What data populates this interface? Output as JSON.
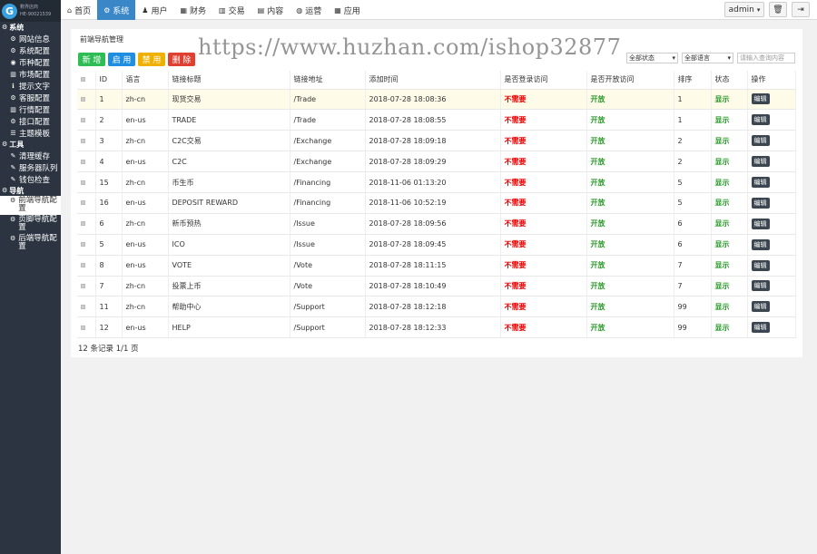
{
  "brand": {
    "line1": "數界店商",
    "line2": "HE-90021539"
  },
  "sidebar": [
    {
      "type": "section",
      "label": "系统",
      "icon": "gear-icon",
      "glyph": "⚙"
    },
    {
      "type": "item",
      "label": "网站信息",
      "icon": "gear-icon",
      "glyph": "⚙"
    },
    {
      "type": "item",
      "label": "系统配置",
      "icon": "gear-icon",
      "glyph": "⚙"
    },
    {
      "type": "item",
      "label": "币种配置",
      "icon": "coin-icon",
      "glyph": "◉"
    },
    {
      "type": "item",
      "label": "市场配置",
      "icon": "chart-icon",
      "glyph": "▥"
    },
    {
      "type": "item",
      "label": "提示文字",
      "icon": "info-icon",
      "glyph": "ℹ"
    },
    {
      "type": "item",
      "label": "客服配置",
      "icon": "gear-icon",
      "glyph": "⚙"
    },
    {
      "type": "item",
      "label": "行情配置",
      "icon": "bar-chart-icon",
      "glyph": "▥"
    },
    {
      "type": "item",
      "label": "接口配置",
      "icon": "gear-icon",
      "glyph": "⚙"
    },
    {
      "type": "item",
      "label": "主题模板",
      "icon": "list-icon",
      "glyph": "☰"
    },
    {
      "type": "section",
      "label": "工具",
      "icon": "gear-icon",
      "glyph": "⚙"
    },
    {
      "type": "item",
      "label": "清理缓存",
      "icon": "wrench-icon",
      "glyph": "✎"
    },
    {
      "type": "item",
      "label": "服务器队列",
      "icon": "wrench-icon",
      "glyph": "✎"
    },
    {
      "type": "item",
      "label": "钱包检查",
      "icon": "wrench-icon",
      "glyph": "✎"
    },
    {
      "type": "section",
      "label": "导航",
      "icon": "gear-icon",
      "glyph": "⚙"
    },
    {
      "type": "item",
      "label": "前端导航配置",
      "icon": "gear-icon",
      "glyph": "⚙",
      "active": true,
      "tall": true
    },
    {
      "type": "item",
      "label": "页脚导航配置",
      "icon": "gear-icon",
      "glyph": "⚙",
      "tall": true
    },
    {
      "type": "item",
      "label": "后端导航配置",
      "icon": "gear-icon",
      "glyph": "⚙",
      "tall": true
    }
  ],
  "topnav": [
    {
      "label": "首页",
      "icon": "home-icon",
      "glyph": "⌂"
    },
    {
      "label": "系统",
      "icon": "gear-icon",
      "glyph": "⚙",
      "active": true
    },
    {
      "label": "用户",
      "icon": "user-icon",
      "glyph": "♟"
    },
    {
      "label": "财务",
      "icon": "table-icon",
      "glyph": "▦"
    },
    {
      "label": "交易",
      "icon": "bar-chart-icon",
      "glyph": "▥"
    },
    {
      "label": "内容",
      "icon": "document-icon",
      "glyph": "▤"
    },
    {
      "label": "运营",
      "icon": "globe-icon",
      "glyph": "◍"
    },
    {
      "label": "应用",
      "icon": "grid-icon",
      "glyph": "▦"
    }
  ],
  "topright": {
    "admin_label": "admin",
    "admin_caret": "▾",
    "trash_glyph": "🗑",
    "logout_glyph": "⇥"
  },
  "panel_title": "前端导航管理",
  "buttons": [
    {
      "label": "新 增",
      "color": "#2ebc54"
    },
    {
      "label": "启 用",
      "color": "#1e8ee0"
    },
    {
      "label": "禁 用",
      "color": "#f0b000"
    },
    {
      "label": "删 除",
      "color": "#e04030"
    }
  ],
  "filters": {
    "status": "全部状态",
    "lang": "全部语言",
    "caret": "▾",
    "search_placeholder": "请输入查询内容"
  },
  "columns": [
    "",
    "ID",
    "语言",
    "链接标题",
    "链接地址",
    "添加时间",
    "是否登录访问",
    "是否开放访问",
    "排序",
    "状态",
    "操作"
  ],
  "rows": [
    {
      "id": "1",
      "lang": "zh-cn",
      "title": "现货交易",
      "url": "/Trade",
      "time": "2018-07-28 18:08:36",
      "login": "不需要",
      "open": "开放",
      "sort": "1",
      "status": "显示",
      "op": "编辑",
      "hl": true
    },
    {
      "id": "2",
      "lang": "en-us",
      "title": "TRADE",
      "url": "/Trade",
      "time": "2018-07-28 18:08:55",
      "login": "不需要",
      "open": "开放",
      "sort": "1",
      "status": "显示",
      "op": "编辑"
    },
    {
      "id": "3",
      "lang": "zh-cn",
      "title": "C2C交易",
      "url": "/Exchange",
      "time": "2018-07-28 18:09:18",
      "login": "不需要",
      "open": "开放",
      "sort": "2",
      "status": "显示",
      "op": "编辑"
    },
    {
      "id": "4",
      "lang": "en-us",
      "title": "C2C",
      "url": "/Exchange",
      "time": "2018-07-28 18:09:29",
      "login": "不需要",
      "open": "开放",
      "sort": "2",
      "status": "显示",
      "op": "编辑"
    },
    {
      "id": "15",
      "lang": "zh-cn",
      "title": "币生币",
      "url": "/Financing",
      "time": "2018-11-06 01:13:20",
      "login": "不需要",
      "open": "开放",
      "sort": "5",
      "status": "显示",
      "op": "编辑"
    },
    {
      "id": "16",
      "lang": "en-us",
      "title": "DEPOSIT REWARD",
      "url": "/Financing",
      "time": "2018-11-06 10:52:19",
      "login": "不需要",
      "open": "开放",
      "sort": "5",
      "status": "显示",
      "op": "编辑"
    },
    {
      "id": "6",
      "lang": "zh-cn",
      "title": "新币预热",
      "url": "/Issue",
      "time": "2018-07-28 18:09:56",
      "login": "不需要",
      "open": "开放",
      "sort": "6",
      "status": "显示",
      "op": "编辑"
    },
    {
      "id": "5",
      "lang": "en-us",
      "title": "ICO",
      "url": "/Issue",
      "time": "2018-07-28 18:09:45",
      "login": "不需要",
      "open": "开放",
      "sort": "6",
      "status": "显示",
      "op": "编辑"
    },
    {
      "id": "8",
      "lang": "en-us",
      "title": "VOTE",
      "url": "/Vote",
      "time": "2018-07-28 18:11:15",
      "login": "不需要",
      "open": "开放",
      "sort": "7",
      "status": "显示",
      "op": "编辑"
    },
    {
      "id": "7",
      "lang": "zh-cn",
      "title": "投票上币",
      "url": "/Vote",
      "time": "2018-07-28 18:10:49",
      "login": "不需要",
      "open": "开放",
      "sort": "7",
      "status": "显示",
      "op": "编辑"
    },
    {
      "id": "11",
      "lang": "zh-cn",
      "title": "帮助中心",
      "url": "/Support",
      "time": "2018-07-28 18:12:18",
      "login": "不需要",
      "open": "开放",
      "sort": "99",
      "status": "显示",
      "op": "编辑"
    },
    {
      "id": "12",
      "lang": "en-us",
      "title": "HELP",
      "url": "/Support",
      "time": "2018-07-28 18:12:33",
      "login": "不需要",
      "open": "开放",
      "sort": "99",
      "status": "显示",
      "op": "编辑"
    }
  ],
  "footer": "12 条记录 1/1 页",
  "watermark": "https://www.huzhan.com/ishop32877"
}
